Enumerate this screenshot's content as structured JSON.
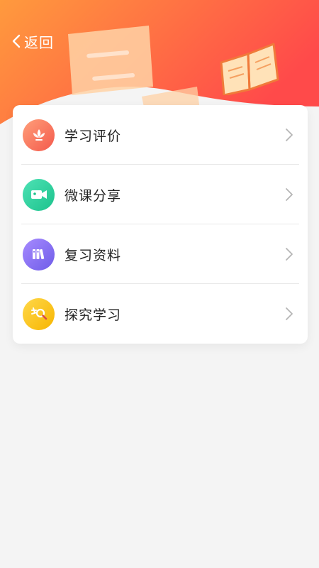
{
  "header": {
    "back_label": "返回",
    "gradient_start": "#ff9a3d",
    "gradient_end": "#ff4a4a"
  },
  "menu": {
    "items": [
      {
        "label": "学习评价",
        "icon": "lotus-icon",
        "color_from": "#ff9f7a",
        "color_to": "#f4594c"
      },
      {
        "label": "微课分享",
        "icon": "video-camera-icon",
        "color_from": "#4ee2b5",
        "color_to": "#1cc28c"
      },
      {
        "label": "复习资料",
        "icon": "books-icon",
        "color_from": "#a78bff",
        "color_to": "#6e5ce8"
      },
      {
        "label": "探究学习",
        "icon": "magnifier-explore-icon",
        "color_from": "#ffd84a",
        "color_to": "#f7b500"
      }
    ]
  },
  "page_background": "#f4f4f4"
}
